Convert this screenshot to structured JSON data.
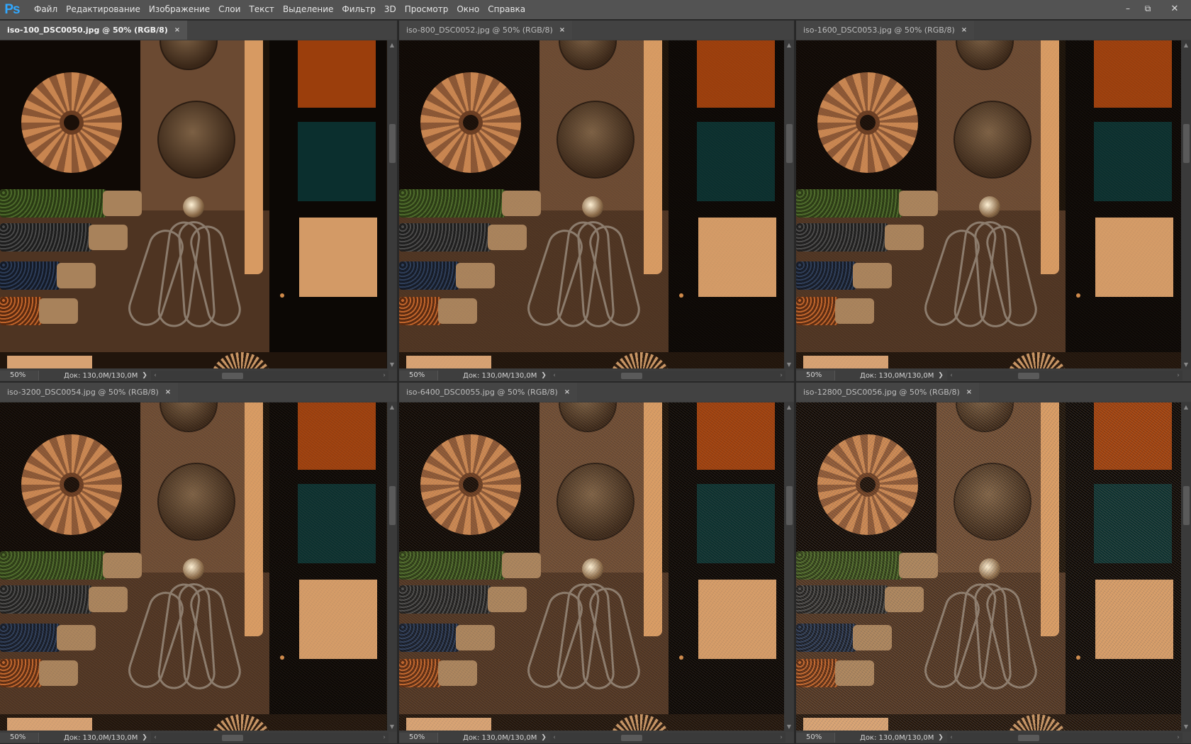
{
  "app": {
    "logo": "Ps",
    "menu": [
      "Файл",
      "Редактирование",
      "Изображение",
      "Слои",
      "Текст",
      "Выделение",
      "Фильтр",
      "3D",
      "Просмотр",
      "Окно",
      "Справка"
    ],
    "window_controls": {
      "minimize": "–",
      "restore": "⧉",
      "close": "✕"
    }
  },
  "documents": [
    {
      "title": "iso-100_DSC0050.jpg @ 50% (RGB/8)",
      "close": "×",
      "zoom": "50%",
      "doc_info": "Док: 130,0M/130,0M",
      "active": true,
      "noise": 0
    },
    {
      "title": "iso-800_DSC0052.jpg @ 50% (RGB/8)",
      "close": "×",
      "zoom": "50%",
      "doc_info": "Док: 130,0M/130,0M",
      "active": false,
      "noise": 0.05
    },
    {
      "title": "iso-1600_DSC0053.jpg @ 50% (RGB/8)",
      "close": "×",
      "zoom": "50%",
      "doc_info": "Док: 130,0M/130,0M",
      "active": false,
      "noise": 0.08
    },
    {
      "title": "iso-3200_DSC0054.jpg @ 50% (RGB/8)",
      "close": "×",
      "zoom": "50%",
      "doc_info": "Док: 130,0M/130,0M",
      "active": false,
      "noise": 0.12
    },
    {
      "title": "iso-6400_DSC0055.jpg @ 50% (RGB/8)",
      "close": "×",
      "zoom": "50%",
      "doc_info": "Док: 130,0M/130,0M",
      "active": false,
      "noise": 0.18
    },
    {
      "title": "iso-12800_DSC0056.jpg @ 50% (RGB/8)",
      "close": "×",
      "zoom": "50%",
      "doc_info": "Док: 130,0M/130,0M",
      "active": false,
      "noise": 0.28
    }
  ],
  "colors": {
    "menubar": "#535353",
    "accent_ps": "#31a8ff",
    "swatch_orange": "#9b3e0c",
    "swatch_teal": "#0b2f2e",
    "swatch_beige": "#d39a66"
  }
}
